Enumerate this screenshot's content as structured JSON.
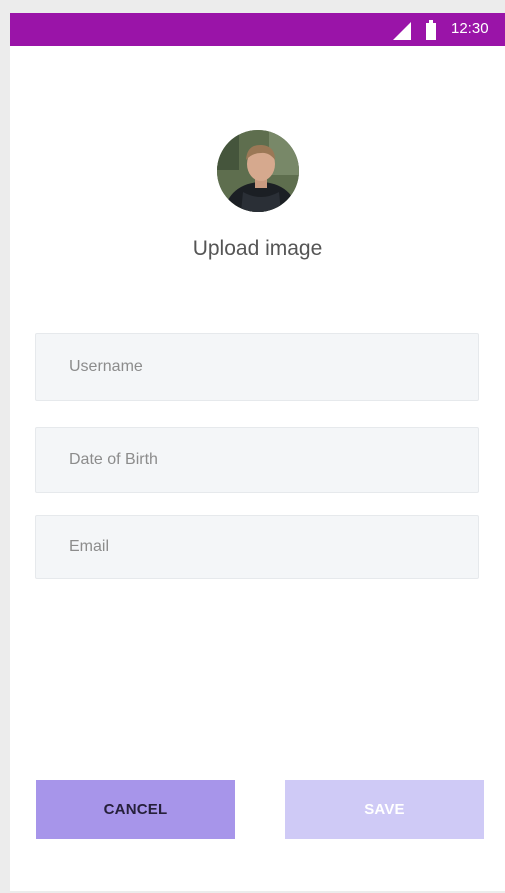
{
  "status_bar": {
    "time": "12:30",
    "signal_icon": "signal-icon",
    "battery_icon": "battery-icon",
    "color": "#9a14a8"
  },
  "profile": {
    "avatar": "avatar",
    "upload_label": "Upload image"
  },
  "form": {
    "username": {
      "placeholder": "Username",
      "value": ""
    },
    "date_of_birth": {
      "placeholder": "Date of Birth",
      "value": ""
    },
    "email": {
      "placeholder": "Email",
      "value": ""
    }
  },
  "actions": {
    "cancel_label": "CANCEL",
    "save_label": "SAVE",
    "cancel_color": "#a795ea",
    "save_color": "#cfcaf6"
  }
}
